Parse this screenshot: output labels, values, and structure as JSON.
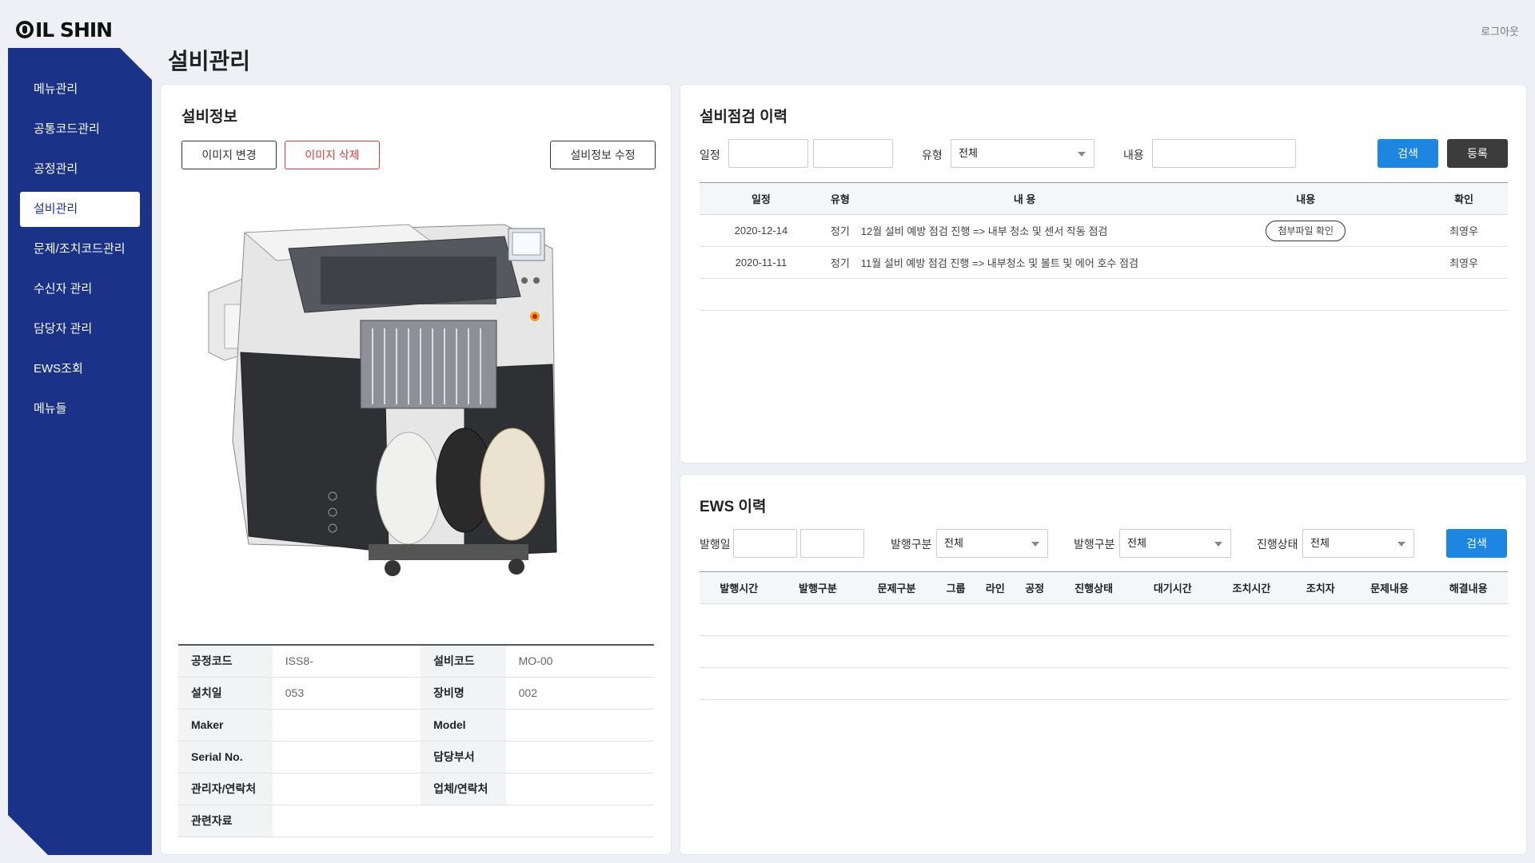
{
  "brand": {
    "logo_text": "IL SHIN"
  },
  "header": {
    "logout": "로그아웃",
    "page_title": "설비관리"
  },
  "sidebar": {
    "items": [
      {
        "label": "메뉴관리"
      },
      {
        "label": "공통코드관리"
      },
      {
        "label": "공정관리"
      },
      {
        "label": "설비관리",
        "active": true
      },
      {
        "label": "문제/조치코드관리"
      },
      {
        "label": "수신자 관리"
      },
      {
        "label": "담당자 관리"
      },
      {
        "label": "EWS조회"
      },
      {
        "label": "메뉴들"
      }
    ]
  },
  "equipment_info": {
    "title": "설비정보",
    "change_image": "이미지 변경",
    "delete_image": "이미지 삭제",
    "edit_info": "설비정보 수정",
    "fields": {
      "process_code_label": "공정코드",
      "process_code": "ISS8-",
      "equipment_code_label": "설비코드",
      "equipment_code": "MO-00",
      "install_date_label": "설치일",
      "install_date": "053",
      "equipment_name_label": "장비명",
      "equipment_name": "002",
      "maker_label": "Maker",
      "maker": "",
      "model_label": "Model",
      "model": "",
      "serial_label": "Serial No.",
      "serial": "",
      "dept_label": "담당부서",
      "dept": "",
      "manager_label": "관리자/연락처",
      "manager": "",
      "vendor_label": "업체/연락처",
      "vendor": "",
      "docs_label": "관련자료",
      "docs": ""
    }
  },
  "inspection": {
    "title": "설비점검 이력",
    "date_label": "일정",
    "type_label": "유형",
    "type_value": "전체",
    "content_label": "내용",
    "search": "검색",
    "register": "등록",
    "columns": [
      "일정",
      "유형",
      "내 용",
      "내용",
      "확인"
    ],
    "rows": [
      {
        "date": "2020-12-14",
        "type": "정기",
        "content": "12월 설비 예방 점검 진행 => 내부 청소 및 센서 작동 점검",
        "attachment": "첨부파일 확인",
        "checker": "최영우"
      },
      {
        "date": "2020-11-11",
        "type": "정기",
        "content": "11월 설비 예방 점검 진행 => 내부청소 및 볼트 및 에어 호수 점검",
        "attachment": "",
        "checker": "최영우"
      }
    ]
  },
  "ews": {
    "title": "EWS 이력",
    "issue_date_label": "발행일",
    "issue_type_label": "발행구분",
    "issue_type_value": "전체",
    "issue_type2_label": "발행구분",
    "issue_type2_value": "전체",
    "status_label": "진행상태",
    "status_value": "전체",
    "search": "검색",
    "columns": [
      "발행시간",
      "발행구분",
      "문제구분",
      "그룹",
      "라인",
      "공정",
      "진행상태",
      "대기시간",
      "조치시간",
      "조치자",
      "문제내용",
      "해결내용"
    ]
  },
  "colors": {
    "sidebar": "#1a3388",
    "primary": "#1d86e0",
    "danger": "#e03a3a"
  }
}
